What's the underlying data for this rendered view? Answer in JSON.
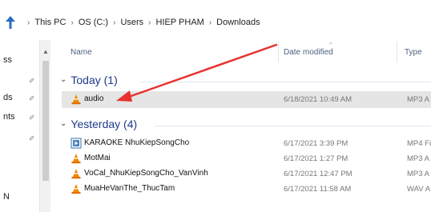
{
  "address": {
    "crumbs": [
      "This PC",
      "OS (C:)",
      "Users",
      "HIEP PHAM",
      "Downloads"
    ]
  },
  "nav_pane": {
    "items": [
      "ss",
      "ds",
      "nts",
      "",
      "N"
    ]
  },
  "columns": {
    "name": "Name",
    "date_modified": "Date modified",
    "type": "Type"
  },
  "groups": [
    {
      "label": "Today (1)",
      "files": [
        {
          "name": "audio",
          "date": "6/18/2021 10:49 AM",
          "type": "MP3 A",
          "icon": "vlc-cone-icon",
          "selected": true
        }
      ]
    },
    {
      "label": "Yesterday (4)",
      "files": [
        {
          "name": "KARAOKE NhuKiepSongCho",
          "date": "6/17/2021 3:39 PM",
          "type": "MP4 Fi",
          "icon": "video-file-icon"
        },
        {
          "name": "MotMai",
          "date": "6/17/2021 1:27 PM",
          "type": "MP3 A",
          "icon": "vlc-cone-icon"
        },
        {
          "name": "VoCal_NhuKiepSongCho_VanVinh",
          "date": "6/17/2021 12:47 PM",
          "type": "MP3 A",
          "icon": "vlc-cone-icon"
        },
        {
          "name": "MuaHeVanThe_ThucTam",
          "date": "6/17/2021 11:58 AM",
          "type": "WAV A",
          "icon": "vlc-cone-icon"
        }
      ]
    }
  ],
  "colors": {
    "group_text": "#1e3a8a",
    "header_text": "#4d6082",
    "selected_row": "#e5e5e5",
    "arrow": "#e8322f",
    "vlc_orange": "#f08a00"
  }
}
